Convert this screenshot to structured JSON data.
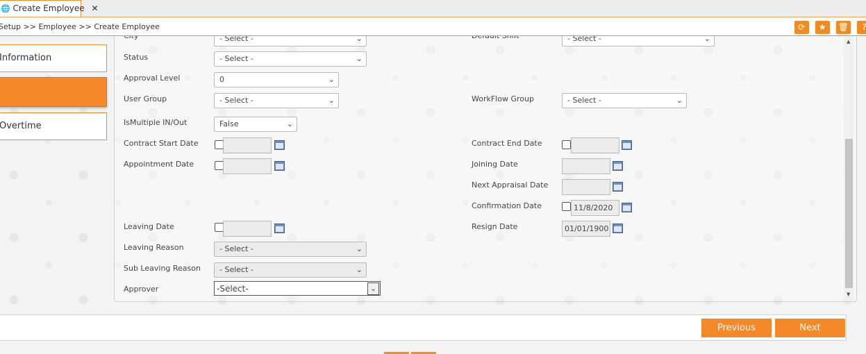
{
  "tab": {
    "title": "Create Employee",
    "close": "✕"
  },
  "breadcrumb": "Setup >> Employee >> Create Employee",
  "menu": {
    "item1": "Information",
    "item3": "Overtime"
  },
  "fields": {
    "city": {
      "label": "City",
      "value": "- Select -"
    },
    "default_shift": {
      "label": "Default Shift",
      "value": "- Select -"
    },
    "status": {
      "label": "Status",
      "value": "- Select -"
    },
    "approval_level": {
      "label": "Approval Level",
      "value": "0"
    },
    "user_group": {
      "label": "User Group",
      "value": "- Select -"
    },
    "workflow_group": {
      "label": "WorkFlow Group",
      "value": "- Select -"
    },
    "ismultiple": {
      "label": "IsMultiple IN/Out",
      "value": "False"
    },
    "contract_start": {
      "label": "Contract Start Date",
      "value": ""
    },
    "contract_end": {
      "label": "Contract End Date",
      "value": ""
    },
    "appointment": {
      "label": "Appointment Date",
      "value": ""
    },
    "joining": {
      "label": "Joining Date",
      "value": ""
    },
    "next_appraisal": {
      "label": "Next Appraisal Date",
      "value": ""
    },
    "confirmation": {
      "label": "Confirmation Date",
      "value": "11/8/2020"
    },
    "leaving": {
      "label": "Leaving Date",
      "value": ""
    },
    "resign": {
      "label": "Resign Date",
      "value": "01/01/1900"
    },
    "leaving_reason": {
      "label": "Leaving Reason",
      "value": "- Select -"
    },
    "sub_leaving_reason": {
      "label": "Sub Leaving Reason",
      "value": "- Select -"
    },
    "approver": {
      "label": "Approver",
      "value": "-Select-"
    }
  },
  "buttons": {
    "previous": "Previous",
    "next": "Next"
  },
  "icons": [
    "globe-icon",
    "refresh-icon",
    "star-icon",
    "trash-icon",
    "help-icon",
    "calendar-icon",
    "chevron-down-icon"
  ],
  "colors": {
    "accent": "#f5892a",
    "border_accent": "#f08c2e"
  }
}
